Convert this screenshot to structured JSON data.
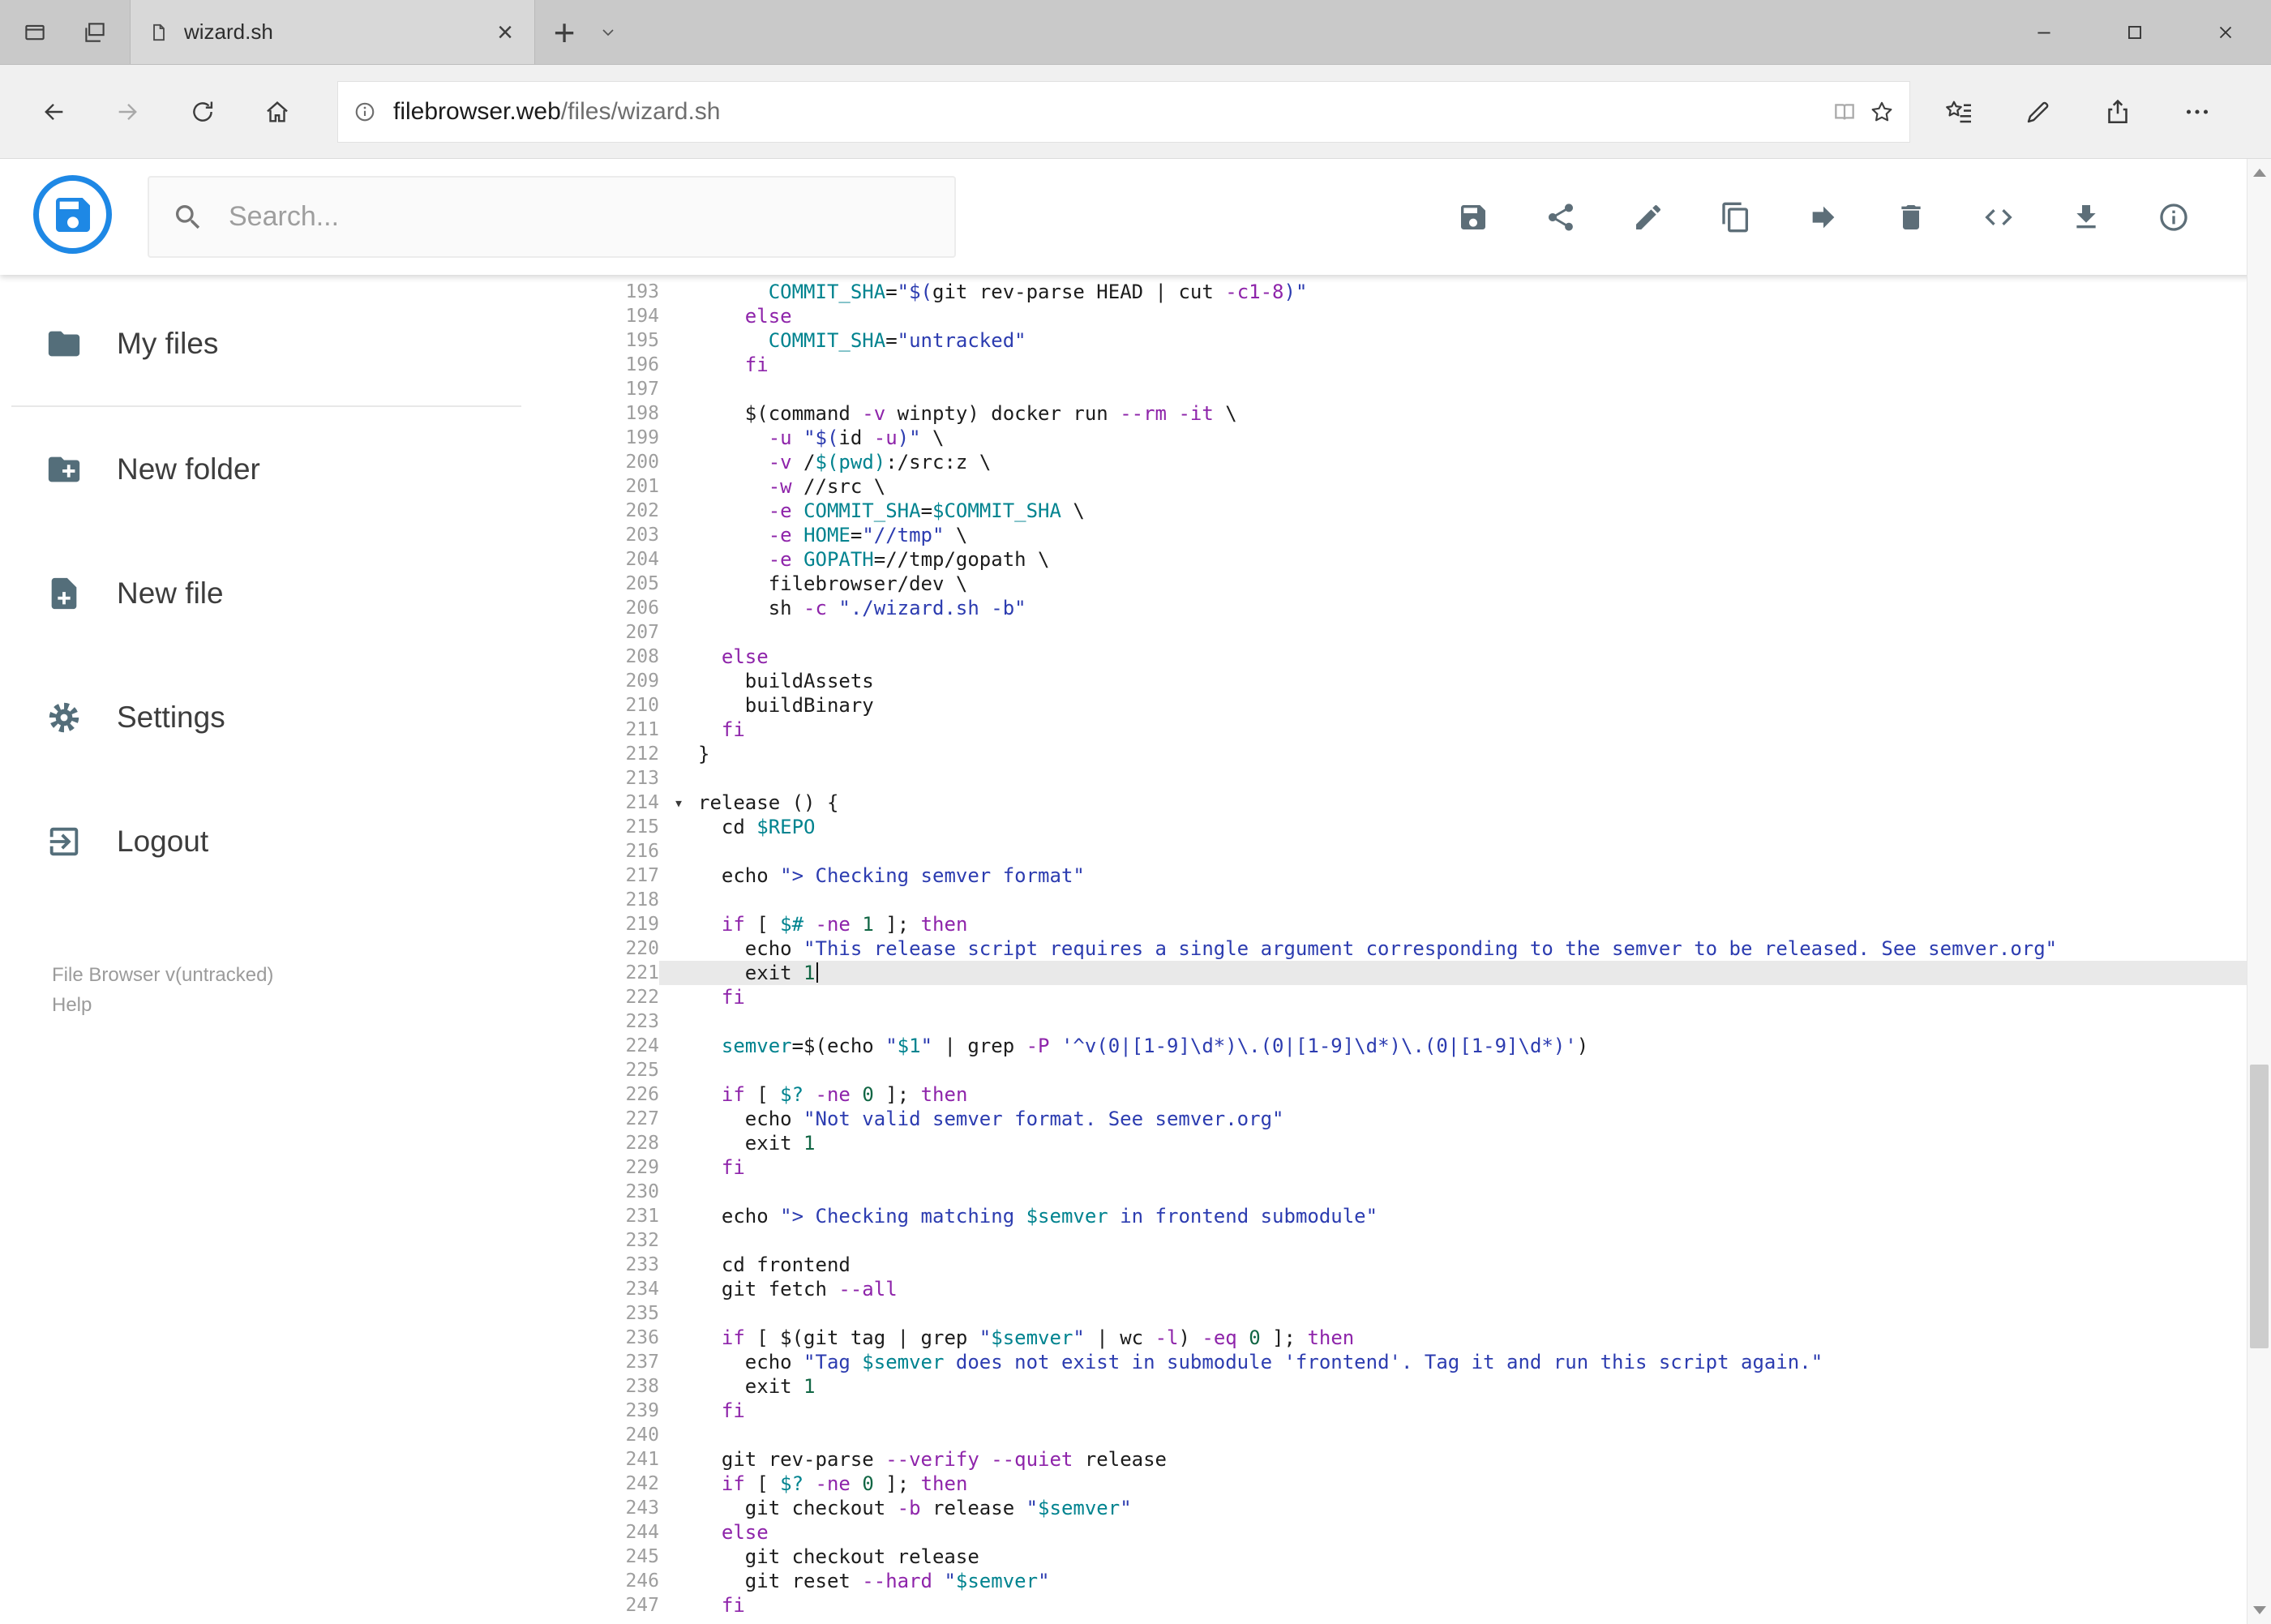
{
  "glyphs": {
    "tab_close": "×",
    "new_tab": "+",
    "fold_marker": "▾"
  },
  "browser": {
    "tab_title": "wizard.sh",
    "url_host": "filebrowser.web",
    "url_path": "/files/wizard.sh"
  },
  "header": {
    "search_placeholder": "Search...",
    "accent_color": "#1e88e5",
    "toolbar": [
      {
        "name": "save",
        "icon": "floppy-icon"
      },
      {
        "name": "share",
        "icon": "share-icon"
      },
      {
        "name": "rename",
        "icon": "pencil-icon"
      },
      {
        "name": "copy",
        "icon": "copy-icon"
      },
      {
        "name": "move",
        "icon": "move-icon"
      },
      {
        "name": "delete",
        "icon": "trash-icon"
      },
      {
        "name": "code-view",
        "icon": "code-icon"
      },
      {
        "name": "download",
        "icon": "download-icon"
      },
      {
        "name": "info",
        "icon": "info-icon"
      }
    ]
  },
  "sidebar": {
    "items": [
      {
        "label": "My files",
        "icon": "folder-icon",
        "divider_after": true
      },
      {
        "label": "New folder",
        "icon": "folder-plus-icon"
      },
      {
        "label": "New file",
        "icon": "file-plus-icon"
      },
      {
        "label": "Settings",
        "icon": "settings-icon"
      },
      {
        "label": "Logout",
        "icon": "logout-icon"
      }
    ],
    "footer": {
      "version": "File Browser v(untracked)",
      "help": "Help"
    }
  },
  "editor": {
    "active_line": 221,
    "fold_line": 214,
    "colors": {
      "text": "#1c1c1c",
      "keyword": "#8e24aa",
      "string": "#2c3cb0",
      "variable": "#00838f",
      "number": "#116644",
      "line_number": "#9e9e9e",
      "active_line_bg": "#e9e9e9"
    },
    "lines": [
      {
        "no": 193,
        "tokens": [
          [
            "t",
            "      "
          ],
          [
            "v",
            "COMMIT_SHA"
          ],
          [
            "t",
            "="
          ],
          [
            "s",
            "\"$("
          ],
          [
            "t",
            "git rev-parse HEAD | cut "
          ],
          [
            "k",
            "-c1-8"
          ],
          [
            "s",
            ")\""
          ]
        ]
      },
      {
        "no": 194,
        "tokens": [
          [
            "t",
            "    "
          ],
          [
            "k",
            "else"
          ]
        ]
      },
      {
        "no": 195,
        "tokens": [
          [
            "t",
            "      "
          ],
          [
            "v",
            "COMMIT_SHA"
          ],
          [
            "t",
            "="
          ],
          [
            "s",
            "\"untracked\""
          ]
        ]
      },
      {
        "no": 196,
        "tokens": [
          [
            "t",
            "    "
          ],
          [
            "k",
            "fi"
          ]
        ]
      },
      {
        "no": 197,
        "tokens": []
      },
      {
        "no": 198,
        "tokens": [
          [
            "t",
            "    $(command "
          ],
          [
            "k",
            "-v"
          ],
          [
            "t",
            " winpty) docker run "
          ],
          [
            "k",
            "--rm"
          ],
          [
            "t",
            " "
          ],
          [
            "k",
            "-it"
          ],
          [
            "t",
            " \\"
          ]
        ]
      },
      {
        "no": 199,
        "tokens": [
          [
            "t",
            "      "
          ],
          [
            "k",
            "-u"
          ],
          [
            "t",
            " "
          ],
          [
            "s",
            "\"$("
          ],
          [
            "t",
            "id "
          ],
          [
            "k",
            "-u"
          ],
          [
            "s",
            ")\""
          ],
          [
            "t",
            " \\"
          ]
        ]
      },
      {
        "no": 200,
        "tokens": [
          [
            "t",
            "      "
          ],
          [
            "k",
            "-v"
          ],
          [
            "t",
            " /"
          ],
          [
            "v",
            "$(pwd)"
          ],
          [
            "t",
            ":/src:z \\"
          ]
        ]
      },
      {
        "no": 201,
        "tokens": [
          [
            "t",
            "      "
          ],
          [
            "k",
            "-w"
          ],
          [
            "t",
            " //src \\"
          ]
        ]
      },
      {
        "no": 202,
        "tokens": [
          [
            "t",
            "      "
          ],
          [
            "k",
            "-e"
          ],
          [
            "t",
            " "
          ],
          [
            "v",
            "COMMIT_SHA"
          ],
          [
            "t",
            "="
          ],
          [
            "v",
            "$COMMIT_SHA"
          ],
          [
            "t",
            " \\"
          ]
        ]
      },
      {
        "no": 203,
        "tokens": [
          [
            "t",
            "      "
          ],
          [
            "k",
            "-e"
          ],
          [
            "t",
            " "
          ],
          [
            "v",
            "HOME"
          ],
          [
            "t",
            "="
          ],
          [
            "s",
            "\"//tmp\""
          ],
          [
            "t",
            " \\"
          ]
        ]
      },
      {
        "no": 204,
        "tokens": [
          [
            "t",
            "      "
          ],
          [
            "k",
            "-e"
          ],
          [
            "t",
            " "
          ],
          [
            "v",
            "GOPATH"
          ],
          [
            "t",
            "=//tmp/gopath \\"
          ]
        ]
      },
      {
        "no": 205,
        "tokens": [
          [
            "t",
            "      filebrowser/dev \\"
          ]
        ]
      },
      {
        "no": 206,
        "tokens": [
          [
            "t",
            "      sh "
          ],
          [
            "k",
            "-c"
          ],
          [
            "t",
            " "
          ],
          [
            "s",
            "\"./wizard.sh -b\""
          ]
        ]
      },
      {
        "no": 207,
        "tokens": []
      },
      {
        "no": 208,
        "tokens": [
          [
            "t",
            "  "
          ],
          [
            "k",
            "else"
          ]
        ]
      },
      {
        "no": 209,
        "tokens": [
          [
            "t",
            "    buildAssets"
          ]
        ]
      },
      {
        "no": 210,
        "tokens": [
          [
            "t",
            "    buildBinary"
          ]
        ]
      },
      {
        "no": 211,
        "tokens": [
          [
            "t",
            "  "
          ],
          [
            "k",
            "fi"
          ]
        ]
      },
      {
        "no": 212,
        "tokens": [
          [
            "t",
            "}"
          ]
        ]
      },
      {
        "no": 213,
        "tokens": []
      },
      {
        "no": 214,
        "tokens": [
          [
            "t",
            "release () {"
          ]
        ]
      },
      {
        "no": 215,
        "tokens": [
          [
            "t",
            "  cd "
          ],
          [
            "v",
            "$REPO"
          ]
        ]
      },
      {
        "no": 216,
        "tokens": []
      },
      {
        "no": 217,
        "tokens": [
          [
            "t",
            "  echo "
          ],
          [
            "s",
            "\"> Checking semver format\""
          ]
        ]
      },
      {
        "no": 218,
        "tokens": []
      },
      {
        "no": 219,
        "tokens": [
          [
            "t",
            "  "
          ],
          [
            "k",
            "if"
          ],
          [
            "t",
            " [ "
          ],
          [
            "v",
            "$#"
          ],
          [
            "t",
            " "
          ],
          [
            "k",
            "-ne"
          ],
          [
            "t",
            " "
          ],
          [
            "n",
            "1"
          ],
          [
            "t",
            " ]; "
          ],
          [
            "k",
            "then"
          ]
        ]
      },
      {
        "no": 220,
        "tokens": [
          [
            "t",
            "    echo "
          ],
          [
            "s",
            "\"This release script requires a single argument corresponding to the semver to be released. See semver.org\""
          ]
        ]
      },
      {
        "no": 221,
        "tokens": [
          [
            "t",
            "    exit "
          ],
          [
            "n",
            "1"
          ]
        ]
      },
      {
        "no": 222,
        "tokens": [
          [
            "t",
            "  "
          ],
          [
            "k",
            "fi"
          ]
        ]
      },
      {
        "no": 223,
        "tokens": []
      },
      {
        "no": 224,
        "tokens": [
          [
            "t",
            "  "
          ],
          [
            "v",
            "semver"
          ],
          [
            "t",
            "=$(echo "
          ],
          [
            "s",
            "\""
          ],
          [
            "v",
            "$1"
          ],
          [
            "s",
            "\""
          ],
          [
            "t",
            " | grep "
          ],
          [
            "k",
            "-P"
          ],
          [
            "t",
            " "
          ],
          [
            "s",
            "'^v(0|[1-9]\\d*)\\.(0|[1-9]\\d*)\\.(0|[1-9]\\d*)'"
          ],
          [
            "t",
            ")"
          ]
        ]
      },
      {
        "no": 225,
        "tokens": []
      },
      {
        "no": 226,
        "tokens": [
          [
            "t",
            "  "
          ],
          [
            "k",
            "if"
          ],
          [
            "t",
            " [ "
          ],
          [
            "v",
            "$?"
          ],
          [
            "t",
            " "
          ],
          [
            "k",
            "-ne"
          ],
          [
            "t",
            " "
          ],
          [
            "n",
            "0"
          ],
          [
            "t",
            " ]; "
          ],
          [
            "k",
            "then"
          ]
        ]
      },
      {
        "no": 227,
        "tokens": [
          [
            "t",
            "    echo "
          ],
          [
            "s",
            "\"Not valid semver format. See semver.org\""
          ]
        ]
      },
      {
        "no": 228,
        "tokens": [
          [
            "t",
            "    exit "
          ],
          [
            "n",
            "1"
          ]
        ]
      },
      {
        "no": 229,
        "tokens": [
          [
            "t",
            "  "
          ],
          [
            "k",
            "fi"
          ]
        ]
      },
      {
        "no": 230,
        "tokens": []
      },
      {
        "no": 231,
        "tokens": [
          [
            "t",
            "  echo "
          ],
          [
            "s",
            "\"> Checking matching "
          ],
          [
            "v",
            "$semver"
          ],
          [
            "s",
            " in frontend submodule\""
          ]
        ]
      },
      {
        "no": 232,
        "tokens": []
      },
      {
        "no": 233,
        "tokens": [
          [
            "t",
            "  cd frontend"
          ]
        ]
      },
      {
        "no": 234,
        "tokens": [
          [
            "t",
            "  git fetch "
          ],
          [
            "k",
            "--all"
          ]
        ]
      },
      {
        "no": 235,
        "tokens": []
      },
      {
        "no": 236,
        "tokens": [
          [
            "t",
            "  "
          ],
          [
            "k",
            "if"
          ],
          [
            "t",
            " [ $(git tag | grep "
          ],
          [
            "s",
            "\""
          ],
          [
            "v",
            "$semver"
          ],
          [
            "s",
            "\""
          ],
          [
            "t",
            " | wc "
          ],
          [
            "k",
            "-l"
          ],
          [
            "t",
            ") "
          ],
          [
            "k",
            "-eq"
          ],
          [
            "t",
            " "
          ],
          [
            "n",
            "0"
          ],
          [
            "t",
            " ]; "
          ],
          [
            "k",
            "then"
          ]
        ]
      },
      {
        "no": 237,
        "tokens": [
          [
            "t",
            "    echo "
          ],
          [
            "s",
            "\"Tag "
          ],
          [
            "v",
            "$semver"
          ],
          [
            "s",
            " does not exist in submodule 'frontend'. Tag it and run this script again.\""
          ]
        ]
      },
      {
        "no": 238,
        "tokens": [
          [
            "t",
            "    exit "
          ],
          [
            "n",
            "1"
          ]
        ]
      },
      {
        "no": 239,
        "tokens": [
          [
            "t",
            "  "
          ],
          [
            "k",
            "fi"
          ]
        ]
      },
      {
        "no": 240,
        "tokens": []
      },
      {
        "no": 241,
        "tokens": [
          [
            "t",
            "  git rev-parse "
          ],
          [
            "k",
            "--verify"
          ],
          [
            "t",
            " "
          ],
          [
            "k",
            "--quiet"
          ],
          [
            "t",
            " release"
          ]
        ]
      },
      {
        "no": 242,
        "tokens": [
          [
            "t",
            "  "
          ],
          [
            "k",
            "if"
          ],
          [
            "t",
            " [ "
          ],
          [
            "v",
            "$?"
          ],
          [
            "t",
            " "
          ],
          [
            "k",
            "-ne"
          ],
          [
            "t",
            " "
          ],
          [
            "n",
            "0"
          ],
          [
            "t",
            " ]; "
          ],
          [
            "k",
            "then"
          ]
        ]
      },
      {
        "no": 243,
        "tokens": [
          [
            "t",
            "    git checkout "
          ],
          [
            "k",
            "-b"
          ],
          [
            "t",
            " release "
          ],
          [
            "s",
            "\""
          ],
          [
            "v",
            "$semver"
          ],
          [
            "s",
            "\""
          ]
        ]
      },
      {
        "no": 244,
        "tokens": [
          [
            "t",
            "  "
          ],
          [
            "k",
            "else"
          ]
        ]
      },
      {
        "no": 245,
        "tokens": [
          [
            "t",
            "    git checkout release"
          ]
        ]
      },
      {
        "no": 246,
        "tokens": [
          [
            "t",
            "    git reset "
          ],
          [
            "k",
            "--hard"
          ],
          [
            "t",
            " "
          ],
          [
            "s",
            "\""
          ],
          [
            "v",
            "$semver"
          ],
          [
            "s",
            "\""
          ]
        ]
      },
      {
        "no": 247,
        "tokens": [
          [
            "t",
            "  "
          ],
          [
            "k",
            "fi"
          ]
        ]
      }
    ]
  },
  "visible_icons": [
    "set-tabs-aside-icon",
    "tabs-stack-icon",
    "page-icon",
    "tab-close-icon",
    "new-tab-icon",
    "chevron-down-icon",
    "minimize-icon",
    "maximize-icon",
    "close-icon",
    "back-icon",
    "forward-icon",
    "refresh-icon",
    "home-icon",
    "site-info-icon",
    "reading-view-icon",
    "favorite-star-icon",
    "hub-icon",
    "web-note-pen-icon",
    "share-arrow-icon",
    "more-icon",
    "logo-icon",
    "search-icon",
    "floppy-icon",
    "share-icon",
    "pencil-icon",
    "copy-icon",
    "move-icon",
    "trash-icon",
    "code-icon",
    "download-icon",
    "info-icon",
    "folder-icon",
    "folder-plus-icon",
    "file-plus-icon",
    "settings-icon",
    "logout-icon",
    "fold-marker-icon",
    "scroll-up-icon",
    "scroll-down-icon"
  ]
}
